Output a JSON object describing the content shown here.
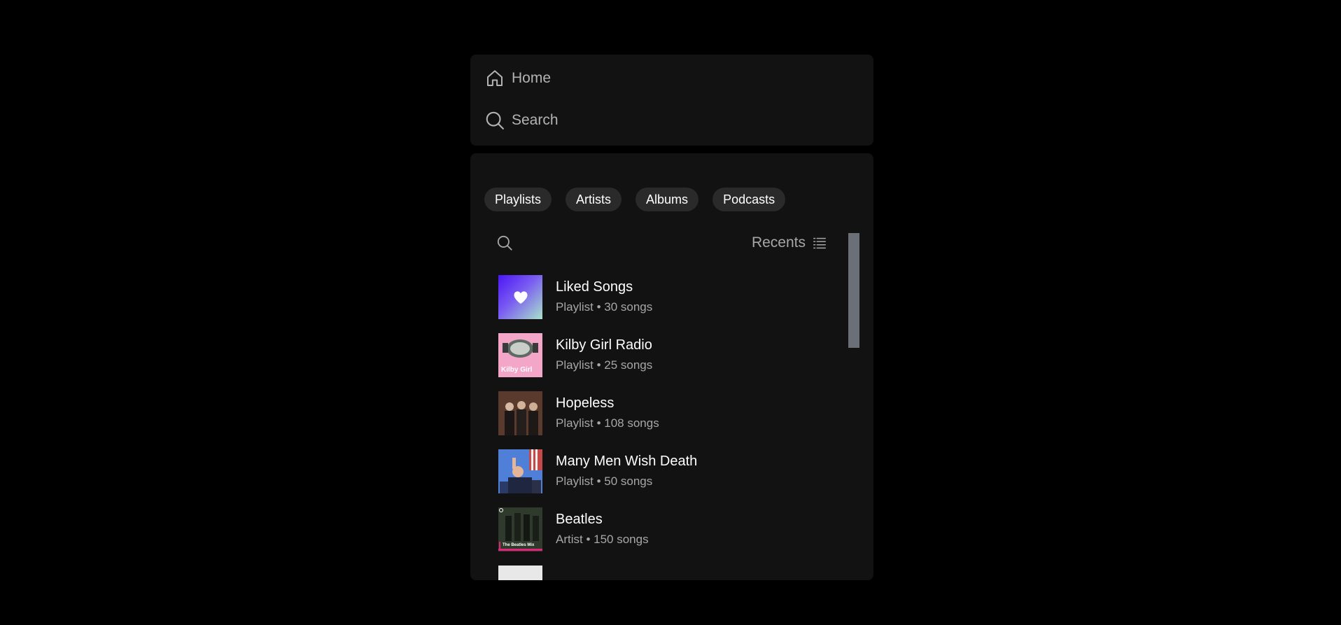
{
  "nav": {
    "home_label": "Home",
    "search_label": "Search"
  },
  "library": {
    "filters": [
      "Playlists",
      "Artists",
      "Albums",
      "Podcasts"
    ],
    "sort_label": "Recents",
    "items": [
      {
        "title": "Liked Songs",
        "subtitle": "Playlist • 30 songs",
        "cover_text": ""
      },
      {
        "title": "Kilby Girl Radio",
        "subtitle": "Playlist • 25 songs",
        "cover_text": "Kilby Girl"
      },
      {
        "title": "Hopeless",
        "subtitle": "Playlist • 108 songs",
        "cover_text": ""
      },
      {
        "title": "Many Men Wish Death",
        "subtitle": "Playlist • 50 songs",
        "cover_text": ""
      },
      {
        "title": "Beatles",
        "subtitle": "Artist • 150 songs",
        "cover_text": "The Beatles Mix"
      }
    ]
  },
  "colors": {
    "background": "#000000",
    "panel": "#121212",
    "chip": "#2a2a2a",
    "text_primary": "#ffffff",
    "text_secondary": "#a7a7a7",
    "scrollbar": "#6b6f77"
  },
  "icons": {
    "home": "home-icon",
    "search": "search-icon",
    "list": "list-icon",
    "heart": "heart-icon"
  }
}
